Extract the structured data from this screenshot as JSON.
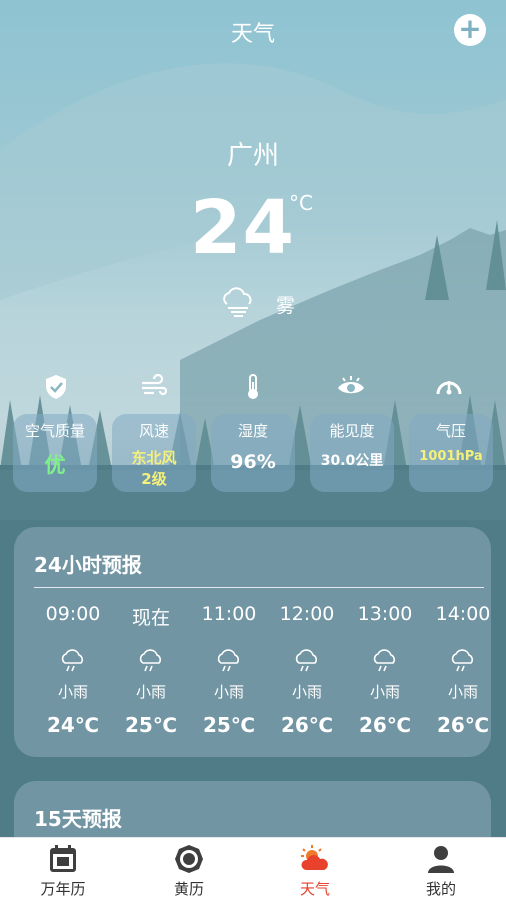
{
  "header": {
    "title": "天气",
    "add_icon": "plus-icon"
  },
  "current": {
    "city": "广州",
    "temperature": "24",
    "unit": "°C",
    "condition": "雾",
    "condition_icon": "fog-cloud-icon"
  },
  "metrics": [
    {
      "label": "空气质量",
      "value": "优",
      "value_color": "#7ff08a",
      "icon": "shield-check-icon"
    },
    {
      "label": "风速",
      "value": "东北风",
      "value2": "2级",
      "value_color": "#f4f07a",
      "icon": "wind-icon"
    },
    {
      "label": "湿度",
      "value": "96%",
      "value_color": "#ffffff",
      "icon": "thermometer-icon"
    },
    {
      "label": "能见度",
      "value": "30.0公里",
      "value_color": "#ffffff",
      "icon": "eye-icon"
    },
    {
      "label": "气压",
      "value": "1001hPa",
      "value_color": "#f4f07a",
      "icon": "gauge-icon"
    }
  ],
  "hourly_forecast": {
    "title": "24小时预报",
    "items": [
      {
        "time": "09:00",
        "condition": "小雨",
        "temp": "24℃",
        "icon": "rain-cloud-icon"
      },
      {
        "time": "现在",
        "condition": "小雨",
        "temp": "25℃",
        "icon": "rain-cloud-icon"
      },
      {
        "time": "11:00",
        "condition": "小雨",
        "temp": "25℃",
        "icon": "rain-cloud-icon"
      },
      {
        "time": "12:00",
        "condition": "小雨",
        "temp": "26℃",
        "icon": "rain-cloud-icon"
      },
      {
        "time": "13:00",
        "condition": "小雨",
        "temp": "26℃",
        "icon": "rain-cloud-icon"
      },
      {
        "time": "14:00",
        "condition": "小雨",
        "temp": "26℃",
        "icon": "rain-cloud-icon"
      }
    ]
  },
  "daily_forecast": {
    "title": "15天预报"
  },
  "bottom_nav": {
    "items": [
      {
        "label": "万年历",
        "icon": "calendar-icon",
        "active": false
      },
      {
        "label": "黄历",
        "icon": "almanac-icon",
        "active": false
      },
      {
        "label": "天气",
        "icon": "weather-sun-cloud-icon",
        "active": true
      },
      {
        "label": "我的",
        "icon": "user-icon",
        "active": false
      }
    ]
  },
  "colors": {
    "accent_active": "#e8412c",
    "air_quality_good": "#7ff08a",
    "highlight_yellow": "#f4f07a"
  }
}
